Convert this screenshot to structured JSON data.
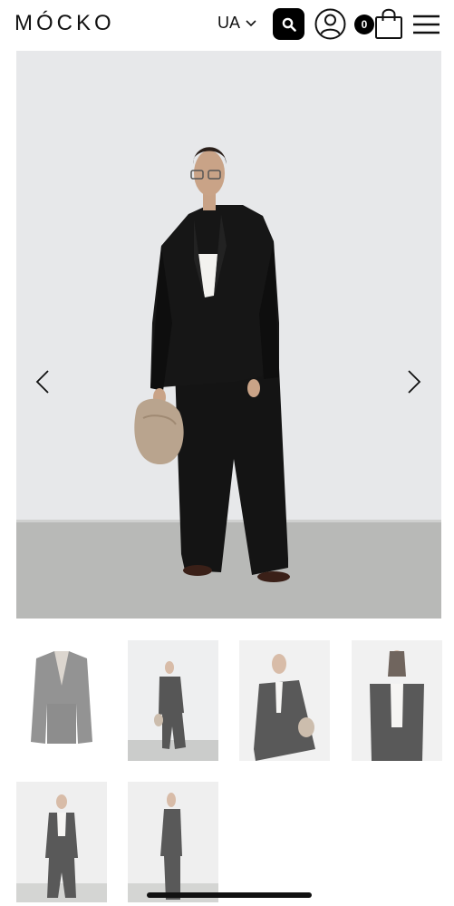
{
  "header": {
    "logo": "MÓCKO",
    "language": "UA",
    "cart_count": "0",
    "icons": [
      "search-icon",
      "account-icon",
      "shopping-bag-icon",
      "menu-icon",
      "chevron-down-icon"
    ]
  },
  "gallery": {
    "arrows": [
      "chevron-left-icon",
      "chevron-right-icon"
    ],
    "colors": {
      "background": "#e7e8ea",
      "floor": "#b8b9b7",
      "suit": "#141414",
      "bag": "#b9a48e"
    }
  },
  "thumbnails": [
    {
      "name": "thumb-jacket-flatlay"
    },
    {
      "name": "thumb-full-look-front"
    },
    {
      "name": "thumb-jacket-closeup"
    },
    {
      "name": "thumb-jacket-open"
    },
    {
      "name": "thumb-full-look-standing"
    },
    {
      "name": "thumb-side-profile"
    }
  ]
}
